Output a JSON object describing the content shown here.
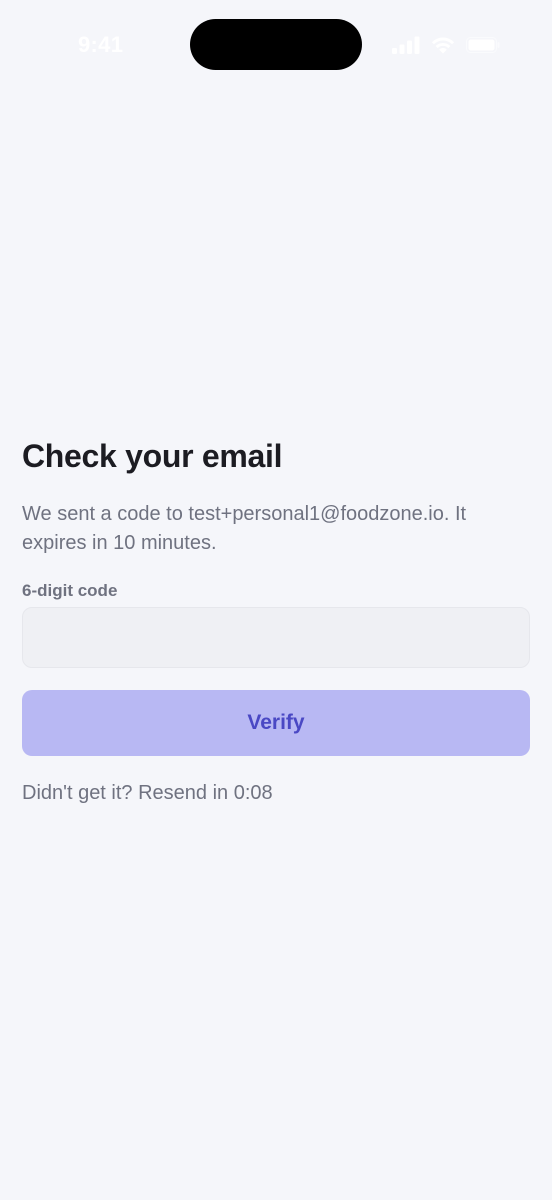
{
  "status_bar": {
    "time": "9:41",
    "icons": [
      "signal-icon",
      "wifi-icon",
      "battery-icon"
    ]
  },
  "screen": {
    "title": "Check your email",
    "description": "We sent a code to test+personal1@foodzone.io. It expires in 10 minutes.",
    "code_field": {
      "label": "6-digit code",
      "value": "",
      "placeholder": ""
    },
    "verify_button_label": "Verify",
    "resend_text": "Didn't get it? Resend in 0:08"
  },
  "colors": {
    "background": "#f5f6fa",
    "title": "#1c1c22",
    "secondary_text": "#6f7280",
    "input_background": "#eff0f4",
    "button_background": "#b8b8f3",
    "button_text": "#4a48c4"
  }
}
